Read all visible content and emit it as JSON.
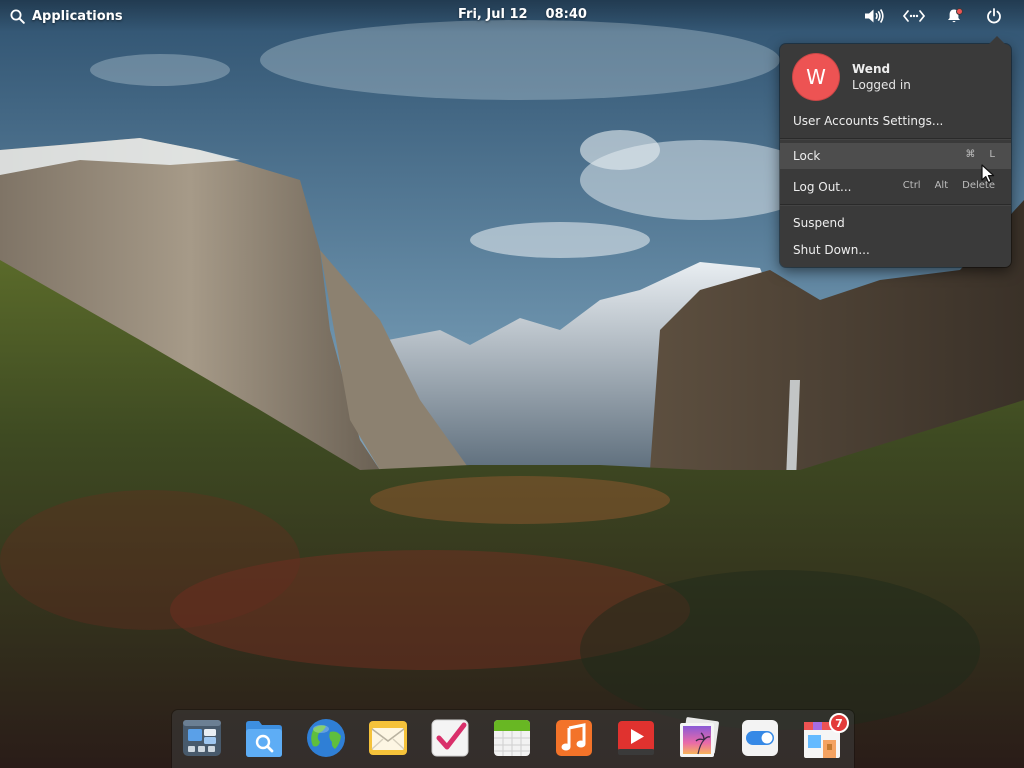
{
  "panel": {
    "applications_label": "Applications",
    "date": "Fri, Jul 12",
    "time": "08:40",
    "indicators": [
      {
        "name": "volume-icon"
      },
      {
        "name": "network-icon"
      },
      {
        "name": "notifications-icon",
        "has_unread": true
      },
      {
        "name": "power-icon"
      }
    ]
  },
  "session_menu": {
    "user": {
      "initial": "W",
      "name": "Wend",
      "status": "Logged in",
      "avatar_color": "#ed5353"
    },
    "user_accounts_label": "User Accounts Settings...",
    "lock": {
      "label": "Lock",
      "shortcut": [
        "⌘",
        "L"
      ]
    },
    "logout": {
      "label": "Log Out...",
      "shortcut": [
        "Ctrl",
        "Alt",
        "Delete"
      ]
    },
    "suspend_label": "Suspend",
    "shutdown_label": "Shut Down..."
  },
  "dock": {
    "items": [
      {
        "name": "multitasking-view"
      },
      {
        "name": "files"
      },
      {
        "name": "web-browser"
      },
      {
        "name": "mail"
      },
      {
        "name": "tasks"
      },
      {
        "name": "calendar"
      },
      {
        "name": "music"
      },
      {
        "name": "videos"
      },
      {
        "name": "photos"
      },
      {
        "name": "system-settings"
      },
      {
        "name": "appcenter",
        "badge": "7"
      }
    ]
  },
  "colors": {
    "accent_red": "#ed5353",
    "menu_background": "#3a3a3a",
    "menu_hover": "#4d4d4d"
  }
}
